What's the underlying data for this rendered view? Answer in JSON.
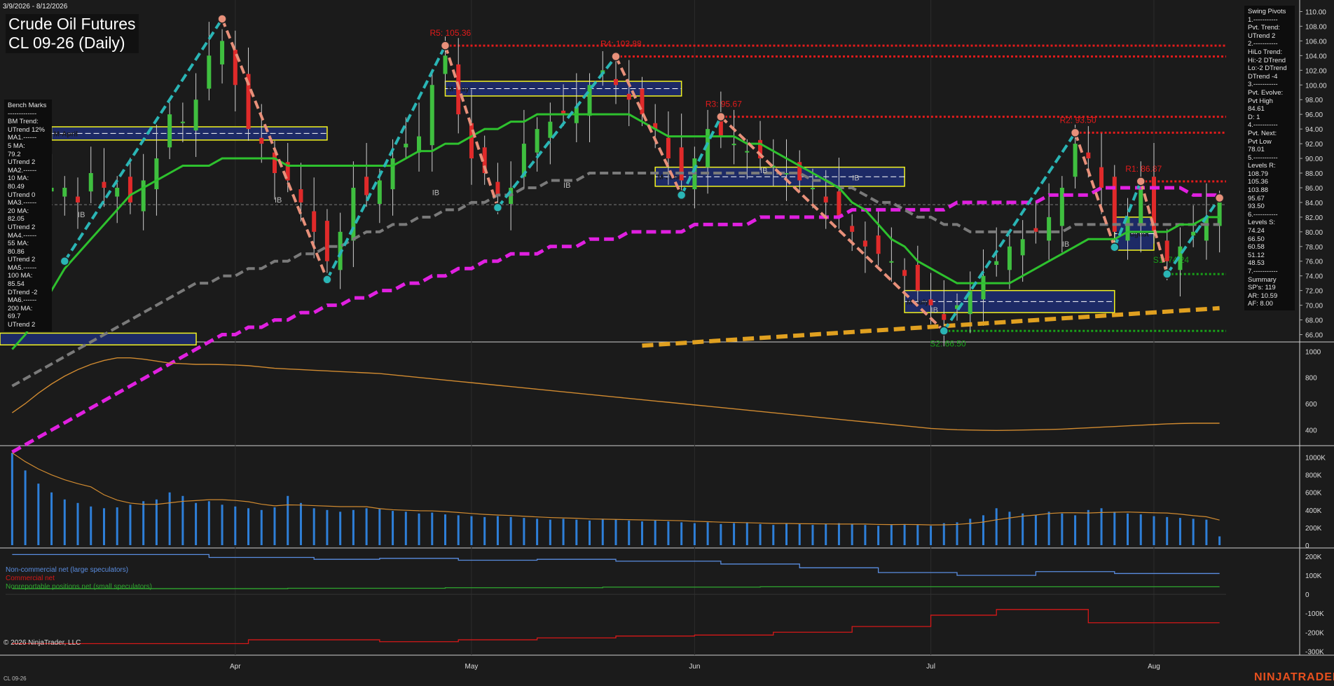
{
  "header": {
    "date_range": "3/9/2026 - 8/12/2026",
    "title_line1": "Crude Oil Futures",
    "title_line2": "CL 09-26 (Daily)"
  },
  "benchmarks": {
    "lines": [
      "Bench Marks",
      "-------------",
      "BM Trend:",
      "UTrend 12%",
      "MA1.------",
      "5 MA:",
      "79.2",
      "UTrend 2",
      "MA2.------",
      "10 MA:",
      "80.49",
      "UTrend 0",
      "MA3.------",
      "20 MA:",
      "82.05",
      "UTrend 2",
      "MA4.------",
      "55 MA:",
      "80.86",
      "UTrend 2",
      "MA5.------",
      "100 MA:",
      "85.54",
      "DTrend -2",
      "MA6.------",
      "200 MA:",
      "69.7",
      "UTrend 2"
    ]
  },
  "swing_panel": {
    "lines": [
      "Swing Pivots",
      "1.-----------",
      "Pvt. Trend:",
      "UTrend 2",
      "2.-----------",
      "HiLo Trend:",
      "Hi:-2 DTrend",
      "Lo:-2 DTrend",
      "DTrend -4",
      "3.-----------",
      "Pvt. Evolve:",
      "Pvt High",
      "84.61",
      "D: 1",
      "4.-----------",
      "Pvt. Next:",
      "Pvt Low",
      "78.01",
      "5.-----------",
      "Levels R:",
      "108.79",
      "105.36",
      "103.88",
      "95.67",
      "93.50",
      "6.-----------",
      "Levels S:",
      "74.24",
      "66.50",
      "60.58",
      "51.12",
      "48.53",
      "7.-----------",
      "Summary",
      "SP's: 119",
      "AR: 10.59",
      "AF: 8.00"
    ]
  },
  "cot_legend": {
    "noncommercial": "Non-commercial net (large speculators)",
    "commercial": "Commercial net",
    "nonreportable": "Nonreportable positions net (small speculators)"
  },
  "footer": {
    "copyright": "© 2026 NinjaTrader, LLC",
    "instrument": "CL 09-26",
    "brand": "NINJATRADER"
  },
  "colors": {
    "background": "#1b1b1b",
    "up_candle": "#3fbf3f",
    "down_candle": "#e02a2a",
    "ma_green": "#2ec12e",
    "ma_gray": "#7a7a7a",
    "ma_magenta": "#e020e0",
    "trend_yellow": "#e0a020",
    "swing_up": "#2ab5b5",
    "swing_down": "#e8907a",
    "resistance": "#e21b1b",
    "support": "#18a018",
    "volume": "#2e7fd8",
    "osc": "#d08a30",
    "cot_noncommercial": "#5a8de0",
    "cot_commercial": "#d51818",
    "cot_nonreportable": "#2fa82f"
  },
  "chart_data": [
    {
      "type": "candlestick",
      "name": "price",
      "x_ticks": [
        "Apr",
        "May",
        "Jun",
        "Jul",
        "Aug"
      ],
      "ylim": [
        65,
        111
      ],
      "y_ticks": [
        66,
        68,
        70,
        72,
        74,
        76,
        78,
        80,
        82,
        84,
        86,
        88,
        90,
        92,
        94,
        96,
        98,
        100,
        102,
        104,
        106,
        108,
        110
      ],
      "y_tick_labels": [
        "66.00",
        "68.00",
        "70.00",
        "72.00",
        "74.00",
        "76.00",
        "78.00",
        "80.00",
        "82.00",
        "84.00",
        "86.00",
        "88.00",
        "90.00",
        "92.00",
        "94.00",
        "96.00",
        "98.00",
        "100.00",
        "102.00",
        "104.00",
        "106.00",
        "108.00",
        "110.00"
      ],
      "resistance_labels": [
        {
          "label": "R5: 105.36",
          "value": 105.36
        },
        {
          "label": "R4: 103.88",
          "value": 103.88
        },
        {
          "label": "R3: 95.67",
          "value": 95.67
        },
        {
          "label": "R2: 93.50",
          "value": 93.5
        },
        {
          "label": "R1: 86.87",
          "value": 86.87
        }
      ],
      "support_labels": [
        {
          "label": "S1: 74.24",
          "value": 74.24
        },
        {
          "label": "S2: 66.50",
          "value": 66.5
        }
      ],
      "month_boxes": [
        "M-April",
        "M-May",
        "M-June",
        "M-July",
        "M-August"
      ],
      "ib_label": "IB",
      "swing_points": [
        {
          "date_index": 4,
          "value": 76.0,
          "kind": "low"
        },
        {
          "date_index": 16,
          "value": 109.0,
          "kind": "high"
        },
        {
          "date_index": 24,
          "value": 73.5,
          "kind": "low"
        },
        {
          "date_index": 33,
          "value": 105.36,
          "kind": "high"
        },
        {
          "date_index": 37,
          "value": 83.3,
          "kind": "low"
        },
        {
          "date_index": 46,
          "value": 103.88,
          "kind": "high"
        },
        {
          "date_index": 51,
          "value": 85.0,
          "kind": "low"
        },
        {
          "date_index": 54,
          "value": 95.67,
          "kind": "high"
        },
        {
          "date_index": 71,
          "value": 66.5,
          "kind": "low"
        },
        {
          "date_index": 81,
          "value": 93.5,
          "kind": "high"
        },
        {
          "date_index": 84,
          "value": 77.9,
          "kind": "low"
        },
        {
          "date_index": 86,
          "value": 86.87,
          "kind": "high"
        },
        {
          "date_index": 88,
          "value": 74.24,
          "kind": "low"
        },
        {
          "date_index": 92,
          "value": 84.61,
          "kind": "high"
        }
      ],
      "close_series": [
        80,
        82,
        84,
        86,
        86,
        84,
        88,
        86,
        86,
        84,
        87,
        90,
        96,
        95,
        98,
        104,
        106,
        100,
        94,
        92,
        88,
        87,
        84,
        80,
        76,
        80,
        86,
        85,
        87,
        90,
        92,
        93,
        100,
        104,
        96,
        90,
        88,
        85,
        86,
        92,
        94,
        95,
        96,
        97,
        100,
        102,
        100,
        98,
        96,
        94,
        90,
        87,
        90,
        94,
        93,
        92,
        91,
        90,
        89,
        88,
        87,
        86,
        84,
        82,
        80,
        78,
        77,
        76,
        74,
        72,
        70,
        68,
        70,
        72,
        74,
        76,
        78,
        79,
        80,
        82,
        86,
        92,
        90,
        86,
        80,
        82,
        86,
        80,
        76,
        78,
        80,
        82,
        84
      ],
      "ma_green": [
        64,
        66,
        69,
        72,
        75,
        77,
        79,
        81,
        83,
        85,
        86,
        87,
        88,
        89,
        89,
        89,
        90,
        90,
        90,
        90,
        90,
        89,
        89,
        89,
        89,
        89,
        89,
        89,
        89,
        89,
        90,
        91,
        91,
        92,
        92,
        93,
        94,
        94,
        95,
        95,
        96,
        96,
        96,
        96,
        96,
        96,
        96,
        96,
        95,
        94,
        93,
        93,
        93,
        93,
        93,
        93,
        92,
        92,
        91,
        90,
        89,
        88,
        87,
        86,
        84,
        83,
        81,
        79,
        78,
        76,
        75,
        74,
        73,
        73,
        73,
        73,
        73,
        74,
        75,
        76,
        77,
        78,
        79,
        79,
        79,
        80,
        80,
        80,
        80,
        81,
        81,
        82,
        82
      ],
      "ma_gray": [
        59,
        60,
        61,
        62,
        63,
        64,
        65,
        66,
        67,
        68,
        69,
        70,
        71,
        72,
        73,
        73,
        74,
        74,
        75,
        75,
        76,
        76,
        77,
        77,
        78,
        78,
        79,
        80,
        80,
        81,
        81,
        82,
        82,
        83,
        83,
        84,
        84,
        85,
        85,
        86,
        86,
        87,
        87,
        87,
        88,
        88,
        88,
        88,
        88,
        88,
        88,
        88,
        88,
        88,
        88,
        88,
        88,
        88,
        88,
        88,
        88,
        87,
        87,
        86,
        86,
        85,
        84,
        84,
        83,
        82,
        82,
        81,
        81,
        80,
        80,
        80,
        80,
        80,
        80,
        80,
        80,
        81,
        81,
        81,
        81,
        81,
        81,
        81,
        81,
        81,
        81,
        81,
        81
      ],
      "ma_magenta": [
        50,
        51,
        52,
        53,
        54,
        55,
        56,
        57,
        58,
        59,
        60,
        61,
        62,
        63,
        64,
        65,
        66,
        66,
        67,
        67,
        68,
        68,
        69,
        69,
        70,
        70,
        71,
        71,
        72,
        72,
        73,
        73,
        74,
        74,
        75,
        75,
        76,
        76,
        77,
        77,
        77,
        78,
        78,
        78,
        79,
        79,
        79,
        80,
        80,
        80,
        80,
        80,
        81,
        81,
        81,
        81,
        81,
        82,
        82,
        82,
        82,
        82,
        82,
        82,
        83,
        83,
        83,
        83,
        83,
        83,
        83,
        83,
        84,
        84,
        84,
        84,
        84,
        84,
        84,
        85,
        85,
        85,
        85,
        86,
        86,
        86,
        86,
        86,
        86,
        86,
        85,
        85,
        85
      ]
    },
    {
      "type": "line",
      "name": "oscillator",
      "ylim": [
        300,
        1050
      ],
      "y_ticks": [
        400,
        600,
        800,
        1000
      ],
      "values": [
        530,
        600,
        680,
        750,
        810,
        860,
        900,
        930,
        950,
        950,
        940,
        925,
        910,
        905,
        900,
        900,
        898,
        895,
        890,
        880,
        870,
        865,
        860,
        855,
        850,
        845,
        840,
        835,
        830,
        820,
        810,
        800,
        790,
        780,
        770,
        760,
        750,
        740,
        730,
        720,
        710,
        700,
        690,
        680,
        670,
        660,
        650,
        640,
        630,
        620,
        610,
        600,
        590,
        580,
        570,
        560,
        550,
        540,
        530,
        520,
        510,
        500,
        490,
        480,
        470,
        460,
        450,
        440,
        430,
        420,
        410,
        405,
        400,
        398,
        396,
        395,
        396,
        398,
        400,
        402,
        405,
        410,
        415,
        420,
        425,
        430,
        435,
        440,
        445,
        448,
        450,
        450,
        450
      ]
    },
    {
      "type": "bar",
      "name": "volume",
      "ylim": [
        0,
        1100000
      ],
      "y_ticks": [
        0,
        200000,
        400000,
        600000,
        800000,
        1000000
      ],
      "y_tick_labels": [
        "0",
        "200K",
        "400K",
        "600K",
        "800K",
        "1000K"
      ],
      "values": [
        1050000,
        850000,
        700000,
        600000,
        520000,
        480000,
        440000,
        420000,
        430000,
        460000,
        500000,
        520000,
        600000,
        560000,
        480000,
        500000,
        460000,
        440000,
        420000,
        400000,
        430000,
        560000,
        480000,
        420000,
        400000,
        380000,
        400000,
        420000,
        410000,
        390000,
        380000,
        360000,
        370000,
        350000,
        340000,
        330000,
        320000,
        330000,
        320000,
        310000,
        300000,
        290000,
        300000,
        290000,
        280000,
        300000,
        290000,
        280000,
        270000,
        280000,
        270000,
        260000,
        250000,
        260000,
        240000,
        250000,
        260000,
        240000,
        230000,
        250000,
        240000,
        230000,
        240000,
        250000,
        240000,
        230000,
        220000,
        230000,
        240000,
        230000,
        220000,
        250000,
        260000,
        300000,
        340000,
        420000,
        380000,
        360000,
        340000,
        380000,
        360000,
        340000,
        400000,
        420000,
        380000,
        360000,
        350000,
        330000,
        320000,
        310000,
        300000,
        290000,
        100000
      ]
    },
    {
      "type": "line",
      "name": "cot",
      "ylim": [
        -310000,
        230000
      ],
      "y_ticks": [
        -300000,
        -200000,
        -100000,
        0,
        100000,
        200000
      ],
      "y_tick_labels": [
        "-300K",
        "-200K",
        "-100K",
        "0",
        "100K",
        "200K"
      ],
      "series": [
        {
          "name": "Non-commercial net (large speculators)",
          "values": [
            210000,
            210000,
            210000,
            210000,
            210000,
            210000,
            210000,
            210000,
            210000,
            210000,
            210000,
            210000,
            210000,
            210000,
            210000,
            195000,
            195000,
            195000,
            195000,
            195000,
            195000,
            195000,
            195000,
            185000,
            185000,
            185000,
            185000,
            185000,
            190000,
            190000,
            190000,
            190000,
            190000,
            190000,
            180000,
            180000,
            180000,
            180000,
            180000,
            180000,
            185000,
            185000,
            185000,
            185000,
            185000,
            185000,
            175000,
            175000,
            175000,
            175000,
            175000,
            175000,
            175000,
            175000,
            160000,
            160000,
            160000,
            160000,
            160000,
            160000,
            140000,
            140000,
            140000,
            140000,
            140000,
            140000,
            115000,
            115000,
            115000,
            115000,
            115000,
            115000,
            100000,
            100000,
            100000,
            100000,
            100000,
            100000,
            120000,
            120000,
            120000,
            120000,
            120000,
            120000,
            110000,
            110000,
            110000,
            110000,
            110000,
            110000,
            110000,
            110000,
            110000
          ]
        },
        {
          "name": "Commercial net",
          "values": [
            -260000,
            -260000,
            -260000,
            -260000,
            -260000,
            -260000,
            -260000,
            -260000,
            -260000,
            -260000,
            -260000,
            -260000,
            -260000,
            -260000,
            -260000,
            -260000,
            -260000,
            -260000,
            -240000,
            -240000,
            -240000,
            -240000,
            -240000,
            -240000,
            -240000,
            -240000,
            -240000,
            -240000,
            -250000,
            -250000,
            -250000,
            -250000,
            -250000,
            -250000,
            -240000,
            -240000,
            -240000,
            -240000,
            -240000,
            -240000,
            -230000,
            -230000,
            -230000,
            -230000,
            -230000,
            -230000,
            -220000,
            -220000,
            -220000,
            -220000,
            -220000,
            -220000,
            -215000,
            -215000,
            -215000,
            -215000,
            -215000,
            -215000,
            -200000,
            -200000,
            -200000,
            -200000,
            -200000,
            -200000,
            -170000,
            -170000,
            -170000,
            -170000,
            -170000,
            -170000,
            -110000,
            -110000,
            -110000,
            -110000,
            -110000,
            -80000,
            -80000,
            -80000,
            -80000,
            -80000,
            -80000,
            -80000,
            -150000,
            -150000,
            -150000,
            -150000,
            -150000,
            -150000,
            -150000,
            -150000,
            -150000,
            -150000,
            -150000
          ]
        },
        {
          "name": "Nonreportable positions net (small speculators)",
          "values": [
            30000,
            30000,
            30000,
            30000,
            30000,
            30000,
            30000,
            30000,
            30000,
            30000,
            30000,
            30000,
            30000,
            30000,
            30000,
            30000,
            30000,
            30000,
            30000,
            30000,
            30000,
            32000,
            32000,
            32000,
            32000,
            32000,
            32000,
            32000,
            32000,
            32000,
            32000,
            32000,
            32000,
            35000,
            35000,
            35000,
            35000,
            35000,
            35000,
            35000,
            35000,
            35000,
            35000,
            35000,
            35000,
            38000,
            38000,
            38000,
            38000,
            38000,
            38000,
            38000,
            38000,
            38000,
            38000,
            38000,
            38000,
            40000,
            40000,
            40000,
            40000,
            40000,
            40000,
            40000,
            40000,
            40000,
            40000,
            40000,
            40000,
            40000,
            40000,
            40000,
            40000,
            40000,
            40000,
            40000,
            40000,
            40000,
            40000,
            40000,
            40000,
            40000,
            40000,
            40000,
            40000,
            40000,
            40000,
            40000,
            40000,
            40000,
            40000,
            40000,
            40000
          ]
        }
      ]
    }
  ]
}
